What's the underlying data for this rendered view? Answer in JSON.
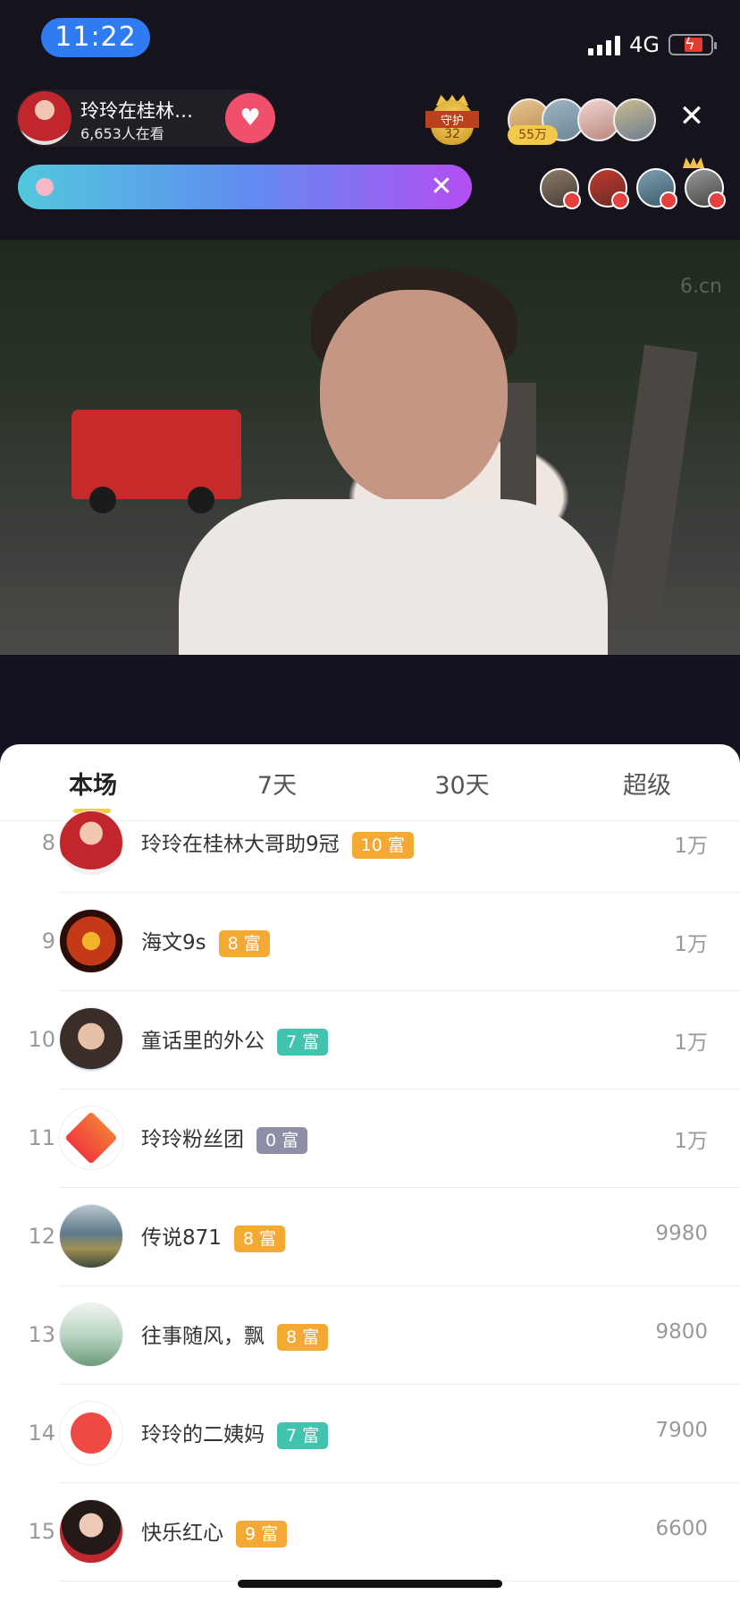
{
  "status_bar": {
    "time": "11:22",
    "network": "4G"
  },
  "host": {
    "name": "玲玲在桂林…",
    "viewers": "6,653人在看"
  },
  "guard": {
    "label": "守护",
    "count": "32"
  },
  "fans": {
    "badge": "55万"
  },
  "tabs": [
    {
      "label": "本场",
      "active": true
    },
    {
      "label": "7天",
      "active": false
    },
    {
      "label": "30天",
      "active": false
    },
    {
      "label": "超级",
      "active": false
    }
  ],
  "video": {
    "watermark": "6.cn"
  },
  "ranking": [
    {
      "rank": "8",
      "name": "玲玲在桂林大哥助9冠",
      "level": "10 富",
      "level_color": "#f3a934",
      "value": "1万"
    },
    {
      "rank": "9",
      "name": "海文9s",
      "level": "8 富",
      "level_color": "#f3a934",
      "value": "1万"
    },
    {
      "rank": "10",
      "name": "童话里的外公",
      "level": "7 富",
      "level_color": "#42c3b0",
      "value": "1万"
    },
    {
      "rank": "11",
      "name": "玲玲粉丝团",
      "level": "0 富",
      "level_color": "#8e8fa6",
      "value": "1万"
    },
    {
      "rank": "12",
      "name": "传说871",
      "level": "8 富",
      "level_color": "#f3a934",
      "value": "9980"
    },
    {
      "rank": "13",
      "name": "往事随风，飘",
      "level": "8 富",
      "level_color": "#f3a934",
      "value": "9800"
    },
    {
      "rank": "14",
      "name": "玲玲的二姨妈",
      "level": "7 富",
      "level_color": "#42c3b0",
      "value": "7900"
    },
    {
      "rank": "15",
      "name": "快乐红心",
      "level": "9 富",
      "level_color": "#f3a934",
      "value": "6600"
    }
  ],
  "colors": {
    "accent": "#2f7bf2",
    "follow": "#f0506c",
    "tab_underline": "#f6cf3a"
  },
  "icons": {
    "follow": "heart-plus-icon",
    "close": "close-icon",
    "guard": "guard-crown-icon",
    "signal": "signal-icon",
    "battery": "battery-icon"
  }
}
